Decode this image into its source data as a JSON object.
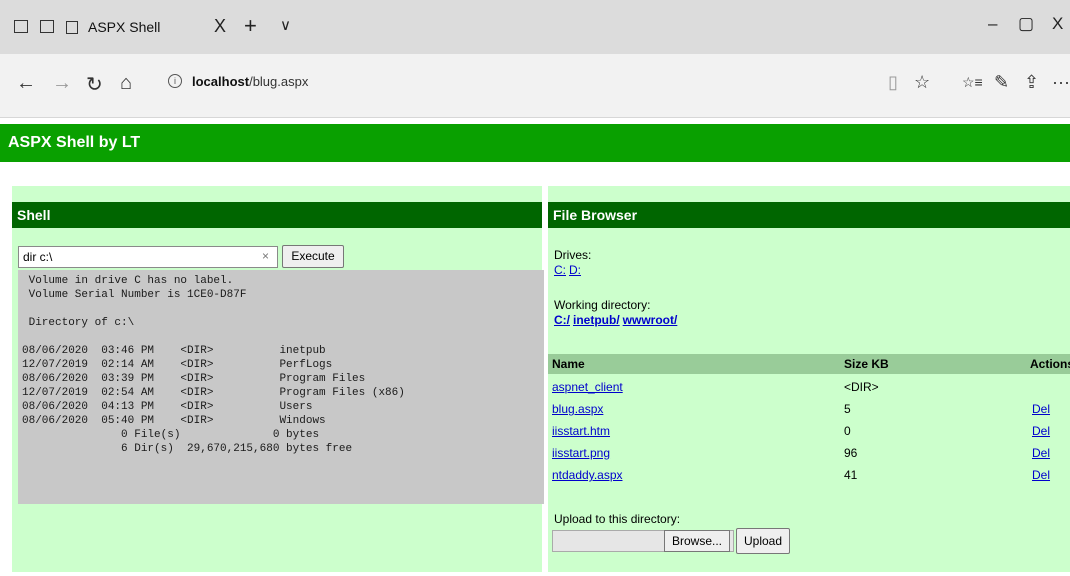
{
  "browser": {
    "tab_title": "ASPX Shell",
    "tab_close": "X",
    "new_tab": "+",
    "tab_menu": "∨",
    "minimize": "–",
    "maximize": "▢",
    "close": "X",
    "url_host": "localhost",
    "url_path": "/blug.aspx",
    "back": "←",
    "forward": "→",
    "refresh": "↻",
    "home": "⌂",
    "info": "i",
    "reading": "▯",
    "favorite": "☆",
    "favorites": "☆≡",
    "notes": "✎",
    "share": "⇪",
    "more": "···"
  },
  "page": {
    "title": "ASPX Shell by LT"
  },
  "shell": {
    "heading": "Shell",
    "command": "dir c:\\",
    "clear": "×",
    "execute_label": "Execute",
    "output": " Volume in drive C has no label.\n Volume Serial Number is 1CE0-D87F\n\n Directory of c:\\\n\n08/06/2020  03:46 PM    <DIR>          inetpub\n12/07/2019  02:14 AM    <DIR>          PerfLogs\n08/06/2020  03:39 PM    <DIR>          Program Files\n12/07/2019  02:54 AM    <DIR>          Program Files (x86)\n08/06/2020  04:13 PM    <DIR>          Users\n08/06/2020  05:40 PM    <DIR>          Windows\n               0 File(s)              0 bytes\n               6 Dir(s)  29,670,215,680 bytes free"
  },
  "file_browser": {
    "heading": "File Browser",
    "drives_label": "Drives:",
    "drives": [
      "C:",
      "D:"
    ],
    "working_dir_label": "Working directory:",
    "path": [
      "C:/",
      "inetpub/",
      "wwwroot/"
    ],
    "columns": {
      "name": "Name",
      "size": "Size KB",
      "actions": "Actions"
    },
    "files": [
      {
        "name": "aspnet_client",
        "size": "<DIR>",
        "action": ""
      },
      {
        "name": "blug.aspx",
        "size": "5",
        "action": "Del"
      },
      {
        "name": "iisstart.htm",
        "size": "0",
        "action": "Del"
      },
      {
        "name": "iisstart.png",
        "size": "96",
        "action": "Del"
      },
      {
        "name": "ntdaddy.aspx",
        "size": "41",
        "action": "Del"
      }
    ],
    "upload_label": "Upload to this directory:",
    "browse_label": "Browse...",
    "upload_button": "Upload"
  },
  "colors": {
    "header_green": "#09a000",
    "panel_head_green": "#006600",
    "panel_bg": "#ccffcc",
    "table_head": "#99cc99",
    "console_bg": "#c8c8c8",
    "link": "#0000cc"
  }
}
